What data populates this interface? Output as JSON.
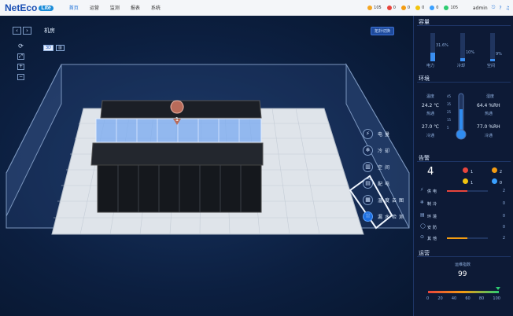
{
  "topbar": {
    "logo": "NetEco",
    "logo_badge": "Lite",
    "nav": [
      "首页",
      "运营",
      "监测",
      "报表",
      "系统"
    ],
    "alarms": [
      {
        "count": "105",
        "color": "#f5a623"
      },
      {
        "count": "0",
        "color": "#e8453c"
      },
      {
        "count": "0",
        "color": "#f39c12"
      },
      {
        "count": "0",
        "color": "#f1c40f"
      },
      {
        "count": "0",
        "color": "#3aa0ff"
      },
      {
        "count": "105",
        "color": "#2ecc71"
      }
    ],
    "user": "admin",
    "icons": [
      "logout-icon",
      "help-icon",
      "bell-icon"
    ]
  },
  "scene": {
    "title": "机房",
    "top_button": "拓扑切换",
    "view_3d": "3D",
    "view_2d": "",
    "rack_marker": "1",
    "legend": [
      {
        "label": "电量",
        "icon": "⚡"
      },
      {
        "label": "冷却",
        "icon": "❄"
      },
      {
        "label": "空间",
        "icon": "▥"
      },
      {
        "label": "配电",
        "icon": "▤"
      },
      {
        "label": "温度云图",
        "icon": "▦"
      },
      {
        "label": "漏水检测",
        "icon": "⛆"
      }
    ]
  },
  "panel": {
    "resources": {
      "title": "容量",
      "bars": [
        {
          "label": "电力",
          "value": "31.6%",
          "level": 0.316
        },
        {
          "label": "冷却",
          "value": "10%",
          "level": 0.1
        },
        {
          "label": "空间",
          "value": "9%",
          "level": 0.09
        }
      ]
    },
    "environment": {
      "title": "环境",
      "temp_label": "温度",
      "humidity_label": "湿度",
      "hot_temp": "24.2 ℃",
      "hot_label": "热通",
      "cold_temp": "27.0 ℃",
      "cold_label": "冷通",
      "hot_hum": "64.4 %RH",
      "cold_hum": "77.0 %RH",
      "thermo_ticks": [
        "45",
        "35",
        "25",
        "15",
        "5"
      ]
    },
    "alarm": {
      "title": "告警",
      "total": "4",
      "counts": [
        {
          "n": "1",
          "color": "#e8453c"
        },
        {
          "n": "2",
          "color": "#f39c12"
        },
        {
          "n": "1",
          "color": "#f1c40f"
        },
        {
          "n": "0",
          "color": "#3aa0ff"
        }
      ],
      "rows": [
        {
          "icon": "⚡",
          "label": "供电",
          "value": "2",
          "level": 0.5,
          "color": "#e8453c"
        },
        {
          "icon": "❄",
          "label": "制冷",
          "value": "0",
          "level": 0,
          "color": "#f39c12"
        },
        {
          "icon": "▤",
          "label": "环境",
          "value": "0",
          "level": 0,
          "color": "#f39c12"
        },
        {
          "icon": "◯",
          "label": "安防",
          "value": "0",
          "level": 0,
          "color": "#f39c12"
        },
        {
          "icon": "⊙",
          "label": "其他",
          "value": "2",
          "level": 0.5,
          "color": "#f39c12"
        }
      ]
    },
    "operations": {
      "title": "运营",
      "pue_label": "运维指数",
      "pue_value": "99",
      "pue_level": 0.99,
      "axis": [
        "0",
        "20",
        "40",
        "60",
        "80",
        "100"
      ]
    }
  }
}
